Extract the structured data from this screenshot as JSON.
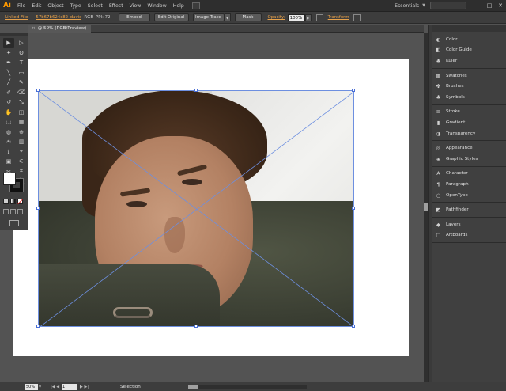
{
  "app": {
    "logo": "Ai"
  },
  "menu": {
    "items": [
      "File",
      "Edit",
      "Object",
      "Type",
      "Select",
      "Effect",
      "View",
      "Window",
      "Help"
    ]
  },
  "workspace": {
    "label": "Essentials"
  },
  "window_controls": {
    "minimize": "—",
    "maximize": "□",
    "close": "✕"
  },
  "control_bar": {
    "linked_file": "Linked File",
    "file_name": "57b67b624c82_david_duchovny.jpg",
    "color_mode": "RGB",
    "ppi": "PPI: 72",
    "embed": "Embed",
    "edit_original": "Edit Original",
    "image_trace": "Image Trace",
    "mask": "Mask",
    "opacity_label": "Opacity:",
    "opacity_value": "100%",
    "transform": "Transform"
  },
  "document": {
    "tab_label": "@ 50% (RGB/Preview)",
    "close": "×"
  },
  "tools": [
    "▶",
    "▷",
    "✦",
    "ʘ",
    "✒",
    "T",
    "╲",
    "▭",
    "╱",
    "✎",
    "✐",
    "⌫",
    "↺",
    "⤡",
    "✋",
    "◫",
    "⬚",
    "▦",
    "◍",
    "⊕",
    "✍",
    "▥",
    "ℹ",
    "⌖",
    "▣",
    "⚟",
    "✂",
    "⌗",
    "✋",
    "🔍"
  ],
  "panels": {
    "groups": [
      [
        {
          "icon": "◐",
          "label": "Color"
        },
        {
          "icon": "◧",
          "label": "Color Guide"
        },
        {
          "icon": "♣",
          "label": "Kuler"
        }
      ],
      [
        {
          "icon": "▦",
          "label": "Swatches"
        },
        {
          "icon": "✤",
          "label": "Brushes"
        },
        {
          "icon": "♣",
          "label": "Symbols"
        }
      ],
      [
        {
          "icon": "≡",
          "label": "Stroke"
        },
        {
          "icon": "▮",
          "label": "Gradient"
        },
        {
          "icon": "◑",
          "label": "Transparency"
        }
      ],
      [
        {
          "icon": "◎",
          "label": "Appearance"
        },
        {
          "icon": "◈",
          "label": "Graphic Styles"
        }
      ],
      [
        {
          "icon": "A",
          "label": "Character"
        },
        {
          "icon": "¶",
          "label": "Paragraph"
        },
        {
          "icon": "○",
          "label": "OpenType"
        }
      ],
      [
        {
          "icon": "◩",
          "label": "Pathfinder"
        }
      ],
      [
        {
          "icon": "◆",
          "label": "Layers"
        },
        {
          "icon": "▢",
          "label": "Artboards"
        }
      ]
    ]
  },
  "status_bar": {
    "zoom": "50%",
    "page": "1",
    "tool": "Selection"
  }
}
